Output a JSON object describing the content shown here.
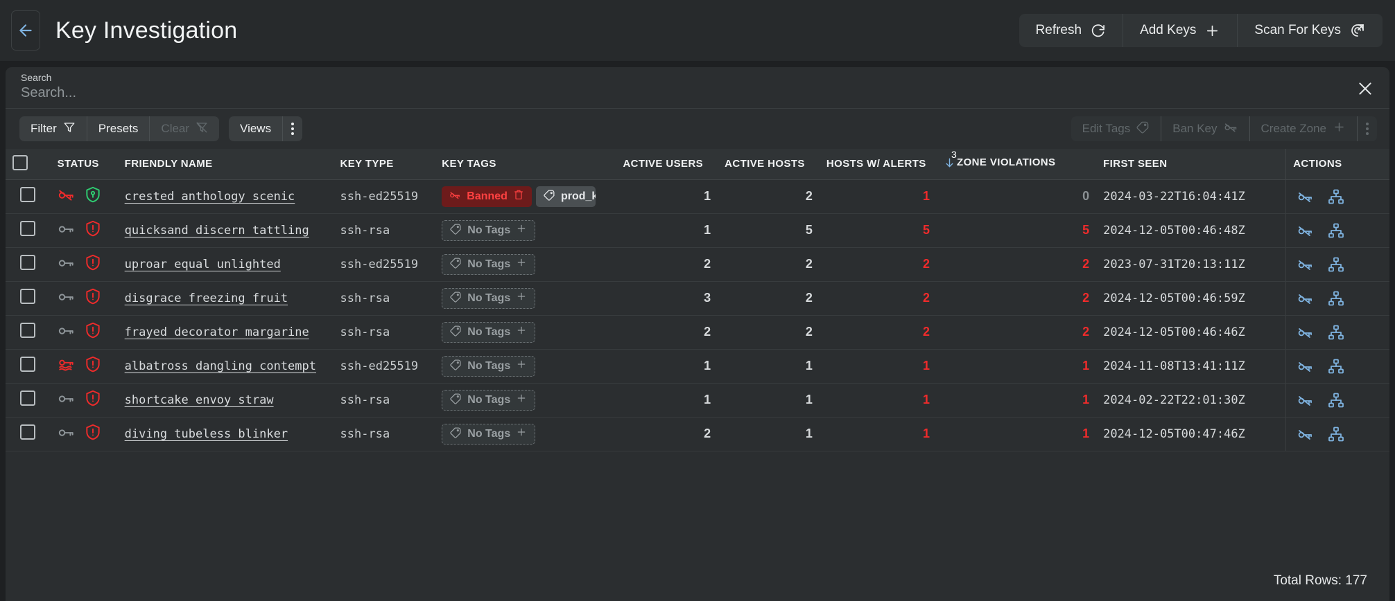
{
  "header": {
    "back_icon": "arrow-left-icon",
    "title": "Key Investigation",
    "actions": [
      {
        "label": "Refresh",
        "icon": "refresh-icon"
      },
      {
        "label": "Add Keys",
        "icon": "plus-icon"
      },
      {
        "label": "Scan For Keys",
        "icon": "scan-target-icon"
      }
    ]
  },
  "search": {
    "label": "Search",
    "placeholder": "Search...",
    "value": "",
    "close_icon": "close-icon"
  },
  "toolbar": {
    "left": [
      {
        "label": "Filter",
        "icon": "filter-icon",
        "disabled": false
      },
      {
        "label": "Presets",
        "icon": "",
        "disabled": false
      },
      {
        "label": "Clear",
        "icon": "filter-off-icon",
        "disabled": true
      }
    ],
    "views": {
      "label": "Views",
      "kebab_icon": "kebab-icon"
    },
    "right": [
      {
        "label": "Edit Tags",
        "icon": "tag-icon",
        "disabled": true
      },
      {
        "label": "Ban Key",
        "icon": "key-off-icon",
        "disabled": true
      },
      {
        "label": "Create Zone",
        "icon": "plus-icon",
        "disabled": true
      }
    ],
    "right_kebab_icon": "kebab-icon"
  },
  "table": {
    "columns": [
      {
        "key": "check",
        "label": ""
      },
      {
        "key": "status",
        "label": "STATUS"
      },
      {
        "key": "name",
        "label": "FRIENDLY NAME"
      },
      {
        "key": "type",
        "label": "KEY TYPE"
      },
      {
        "key": "tags",
        "label": "KEY TAGS"
      },
      {
        "key": "users",
        "label": "ACTIVE USERS"
      },
      {
        "key": "hosts",
        "label": "ACTIVE HOSTS"
      },
      {
        "key": "alerts",
        "label": "HOSTS W/ ALERTS"
      },
      {
        "key": "zone",
        "label": "ZONE VIOLATIONS"
      },
      {
        "key": "first",
        "label": "FIRST SEEN"
      },
      {
        "key": "actions",
        "label": "ACTIONS"
      }
    ],
    "sort": {
      "column": "ZONE VIOLATIONS",
      "direction": "desc",
      "order_badge": "3"
    },
    "rows": [
      {
        "status_icons": [
          "key-off-red-icon",
          "shield-key-green-icon"
        ],
        "name": "crested anthology scenic",
        "type": "ssh-ed25519",
        "tags": [
          {
            "text": "Banned",
            "style": "banned",
            "icon": "key-off-icon",
            "trailing_icon": "trash-icon"
          },
          {
            "text": "prod_ke",
            "style": "normal",
            "icon": "tag-icon"
          }
        ],
        "users": "1",
        "hosts": "2",
        "alerts": "1",
        "zone": "0",
        "zone_alert": false,
        "first_seen": "2024-03-22T16:04:41Z"
      },
      {
        "status_icons": [
          "key-gray-icon",
          "shield-alert-red-icon"
        ],
        "name": "quicksand discern tattling",
        "type": "ssh-rsa",
        "tags": [
          {
            "text": "No Tags",
            "style": "empty",
            "icon": "tag-icon",
            "trailing_icon": "plus-icon"
          }
        ],
        "users": "1",
        "hosts": "5",
        "alerts": "5",
        "zone": "5",
        "zone_alert": true,
        "first_seen": "2024-12-05T00:46:48Z"
      },
      {
        "status_icons": [
          "key-gray-icon",
          "shield-alert-red-icon"
        ],
        "name": "uproar equal unlighted",
        "type": "ssh-ed25519",
        "tags": [
          {
            "text": "No Tags",
            "style": "empty",
            "icon": "tag-icon",
            "trailing_icon": "plus-icon"
          }
        ],
        "users": "2",
        "hosts": "2",
        "alerts": "2",
        "zone": "2",
        "zone_alert": true,
        "first_seen": "2023-07-31T20:13:11Z"
      },
      {
        "status_icons": [
          "key-gray-icon",
          "shield-alert-red-icon"
        ],
        "name": "disgrace freezing fruit",
        "type": "ssh-rsa",
        "tags": [
          {
            "text": "No Tags",
            "style": "empty",
            "icon": "tag-icon",
            "trailing_icon": "plus-icon"
          }
        ],
        "users": "3",
        "hosts": "2",
        "alerts": "2",
        "zone": "2",
        "zone_alert": true,
        "first_seen": "2024-12-05T00:46:59Z"
      },
      {
        "status_icons": [
          "key-gray-icon",
          "shield-alert-red-icon"
        ],
        "name": "frayed decorator margarine",
        "type": "ssh-rsa",
        "tags": [
          {
            "text": "No Tags",
            "style": "empty",
            "icon": "tag-icon",
            "trailing_icon": "plus-icon"
          }
        ],
        "users": "2",
        "hosts": "2",
        "alerts": "2",
        "zone": "2",
        "zone_alert": true,
        "first_seen": "2024-12-05T00:46:46Z"
      },
      {
        "status_icons": [
          "keys-multi-red-icon",
          "shield-alert-red-icon"
        ],
        "name": "albatross dangling contempt",
        "type": "ssh-ed25519",
        "tags": [
          {
            "text": "No Tags",
            "style": "empty",
            "icon": "tag-icon",
            "trailing_icon": "plus-icon"
          }
        ],
        "users": "1",
        "hosts": "1",
        "alerts": "1",
        "zone": "1",
        "zone_alert": true,
        "first_seen": "2024-11-08T13:41:11Z"
      },
      {
        "status_icons": [
          "key-gray-icon",
          "shield-alert-red-icon"
        ],
        "name": "shortcake envoy straw",
        "type": "ssh-rsa",
        "tags": [
          {
            "text": "No Tags",
            "style": "empty",
            "icon": "tag-icon",
            "trailing_icon": "plus-icon"
          }
        ],
        "users": "1",
        "hosts": "1",
        "alerts": "1",
        "zone": "1",
        "zone_alert": true,
        "first_seen": "2024-02-22T22:01:30Z"
      },
      {
        "status_icons": [
          "key-gray-icon",
          "shield-alert-red-icon"
        ],
        "name": "diving tubeless blinker",
        "type": "ssh-rsa",
        "tags": [
          {
            "text": "No Tags",
            "style": "empty",
            "icon": "tag-icon",
            "trailing_icon": "plus-icon"
          }
        ],
        "users": "2",
        "hosts": "1",
        "alerts": "1",
        "zone": "1",
        "zone_alert": true,
        "first_seen": "2024-12-05T00:47:46Z"
      }
    ],
    "row_actions": [
      {
        "icon": "key-off-icon",
        "name": "ban-key-action"
      },
      {
        "icon": "sitemap-icon",
        "name": "view-zone-action"
      }
    ]
  },
  "footer": {
    "total_rows": "Total Rows: 177"
  },
  "colors": {
    "accent": "#7fb3e0",
    "alert": "#f02b2b",
    "ok": "#2ecc71",
    "banned_bg": "#6d1b1b",
    "panel": "#2b2e30",
    "header": "#272a2c"
  }
}
